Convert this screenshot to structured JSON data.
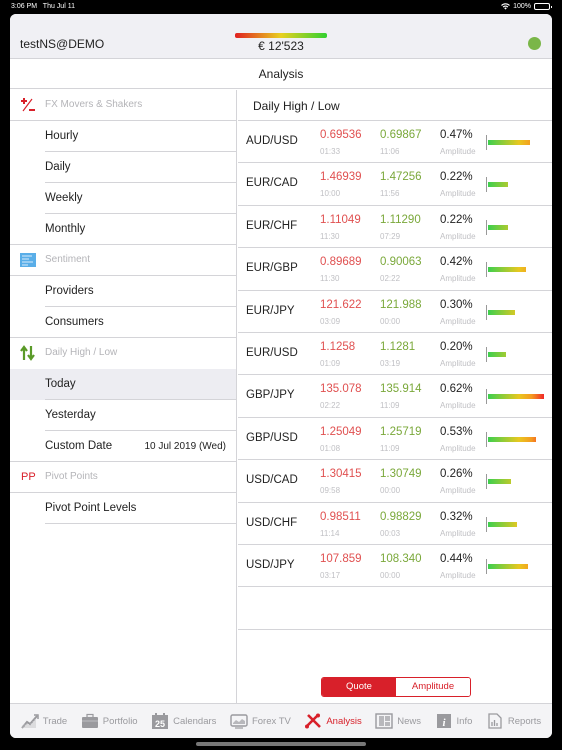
{
  "status_bar": {
    "time": "3:06 PM",
    "date": "Thu Jul 11",
    "battery": "100%"
  },
  "header": {
    "account": "testNS@DEMO",
    "equity": "€ 12'523",
    "connection_color": "#7ab648"
  },
  "title": "Analysis",
  "sidebar": {
    "sections": [
      {
        "icon": "plus-minus-icon",
        "label": "FX Movers & Shakers",
        "items": [
          {
            "label": "Hourly"
          },
          {
            "label": "Daily"
          },
          {
            "label": "Weekly"
          },
          {
            "label": "Monthly"
          }
        ]
      },
      {
        "icon": "sentiment-icon",
        "label": "Sentiment",
        "items": [
          {
            "label": "Providers"
          },
          {
            "label": "Consumers"
          }
        ]
      },
      {
        "icon": "up-down-arrows-icon",
        "label": "Daily High / Low",
        "items": [
          {
            "label": "Today",
            "selected": true
          },
          {
            "label": "Yesterday"
          },
          {
            "label": "Custom Date",
            "value": "10 Jul 2019 (Wed)"
          }
        ]
      },
      {
        "icon": "pivot-points-icon",
        "icon_text": "PP",
        "label": "Pivot Points",
        "items": [
          {
            "label": "Pivot Point Levels"
          }
        ]
      }
    ]
  },
  "main": {
    "heading": "Daily High / Low",
    "amplitude_label": "Amplitude",
    "rows": [
      {
        "pair": "AUD/USD",
        "low": "0.69536",
        "low_time": "01:33",
        "high": "0.69867",
        "high_time": "11:06",
        "amplitude": "0.47%",
        "amplitude_value": 0.47
      },
      {
        "pair": "EUR/CAD",
        "low": "1.46939",
        "low_time": "10:00",
        "high": "1.47256",
        "high_time": "11:56",
        "amplitude": "0.22%",
        "amplitude_value": 0.22
      },
      {
        "pair": "EUR/CHF",
        "low": "1.11049",
        "low_time": "11:30",
        "high": "1.11290",
        "high_time": "07:29",
        "amplitude": "0.22%",
        "amplitude_value": 0.22
      },
      {
        "pair": "EUR/GBP",
        "low": "0.89689",
        "low_time": "11:30",
        "high": "0.90063",
        "high_time": "02:22",
        "amplitude": "0.42%",
        "amplitude_value": 0.42
      },
      {
        "pair": "EUR/JPY",
        "low": "121.622",
        "low_time": "03:09",
        "high": "121.988",
        "high_time": "00:00",
        "amplitude": "0.30%",
        "amplitude_value": 0.3
      },
      {
        "pair": "EUR/USD",
        "low": "1.1258",
        "low_time": "01:09",
        "high": "1.1281",
        "high_time": "03:19",
        "amplitude": "0.20%",
        "amplitude_value": 0.2
      },
      {
        "pair": "GBP/JPY",
        "low": "135.078",
        "low_time": "02:22",
        "high": "135.914",
        "high_time": "11:09",
        "amplitude": "0.62%",
        "amplitude_value": 0.62
      },
      {
        "pair": "GBP/USD",
        "low": "1.25049",
        "low_time": "01:08",
        "high": "1.25719",
        "high_time": "11:09",
        "amplitude": "0.53%",
        "amplitude_value": 0.53
      },
      {
        "pair": "USD/CAD",
        "low": "1.30415",
        "low_time": "09:58",
        "high": "1.30749",
        "high_time": "00:00",
        "amplitude": "0.26%",
        "amplitude_value": 0.26
      },
      {
        "pair": "USD/CHF",
        "low": "0.98511",
        "low_time": "11:14",
        "high": "0.98829",
        "high_time": "00:03",
        "amplitude": "0.32%",
        "amplitude_value": 0.32
      },
      {
        "pair": "USD/JPY",
        "low": "107.859",
        "low_time": "03:17",
        "high": "108.340",
        "high_time": "00:00",
        "amplitude": "0.44%",
        "amplitude_value": 0.44
      }
    ],
    "segment": {
      "options": [
        "Quote",
        "Amplitude"
      ],
      "selected": "Quote"
    }
  },
  "tabbar": {
    "tabs": [
      {
        "label": "Trade",
        "icon": "trade-chart-icon"
      },
      {
        "label": "Portfolio",
        "icon": "briefcase-icon"
      },
      {
        "label": "Calendars",
        "icon": "calendar-icon"
      },
      {
        "label": "Forex TV",
        "icon": "tv-icon"
      },
      {
        "label": "Analysis",
        "icon": "tools-icon",
        "active": true
      },
      {
        "label": "News",
        "icon": "newspaper-icon"
      },
      {
        "label": "Info",
        "icon": "info-icon"
      },
      {
        "label": "Reports",
        "icon": "report-icon"
      }
    ]
  },
  "colors": {
    "accent": "#d8202a",
    "low": "#e05050",
    "high": "#7aa83a"
  }
}
